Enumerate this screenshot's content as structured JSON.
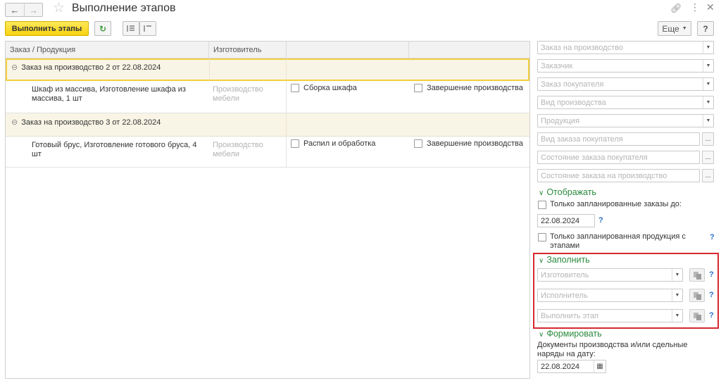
{
  "header": {
    "back_icon": "arrow-left-icon",
    "forward_icon": "arrow-right-icon",
    "favorite_icon": "star-icon",
    "title": "Выполнение этапов",
    "link_icon": "link-icon",
    "more_icon": "kebab-menu-icon",
    "close_icon": "close-icon"
  },
  "toolbar": {
    "execute_label": "Выполнить этапы",
    "refresh_icon": "refresh-icon",
    "expand_icon": "expand-list-icon",
    "collapse_icon": "collapse-list-icon",
    "more_label": "Еще",
    "help_label": "?"
  },
  "table": {
    "columns": [
      "Заказ / Продукция",
      "Изготовитель",
      "",
      ""
    ],
    "groups": [
      {
        "order": "Заказ на производство 2 от 22.08.2024",
        "selected": true,
        "product": "Шкаф из массива, Изготовление шкафа из массива, 1 шт",
        "maker": "Производство мебели",
        "stage1": "Сборка шкафа",
        "stage2": "Завершение производства"
      },
      {
        "order": "Заказ на производство 3 от 22.08.2024",
        "selected": false,
        "product": "Готовый брус, Изготовление готового бруса, 4 шт",
        "maker": "Производство мебели",
        "stage1": "Распил и обработка",
        "stage2": "Завершение производства"
      }
    ]
  },
  "filters": {
    "production_order": "Заказ на производство",
    "customer": "Заказчик",
    "customer_order": "Заказ покупателя",
    "production_type": "Вид производства",
    "product": "Продукция",
    "customer_order_type": "Вид заказа покупателя",
    "customer_order_state": "Состояние заказа покупателя",
    "production_order_state": "Состояние заказа на производство"
  },
  "display": {
    "title": "Отображать",
    "only_planned_label": "Только запланированные заказы до:",
    "only_planned_date": "22.08.2024",
    "only_planned_products_label": "Только запланированная продукция с этапами",
    "help": "?"
  },
  "fill": {
    "title": "Заполнить",
    "maker_placeholder": "Изготовитель",
    "executor_placeholder": "Исполнитель",
    "stage_placeholder": "Выполнить этап",
    "help": "?"
  },
  "form": {
    "title": "Формировать",
    "label": "Документы производства и/или сдельные наряды на дату:",
    "date": "22.08.2024"
  },
  "colors": {
    "accent_yellow": "#f6d30e",
    "section_green": "#2b8a3e",
    "highlight_red": "#d6282e",
    "group_bg": "#f8f5e6"
  }
}
